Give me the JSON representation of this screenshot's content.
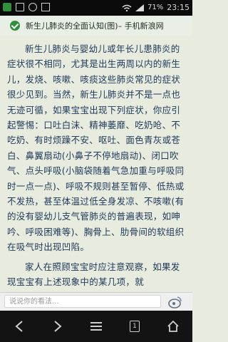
{
  "status": {
    "time": "23:15",
    "battery": "71%"
  },
  "page": {
    "title": "新生儿肺炎的全面认知(图)– 手机新浪网"
  },
  "article": {
    "paragraphs": [
      "新生儿肺炎与婴幼儿或年长儿患肺炎的症状很不相同，尤其是出生两周以内的新生儿，发烧、咳嗽、咳痰这些肺炎常见的症状很少见到。当然，新生儿肺炎并不是一点也无迹可循，如果宝宝出现下列症状，你应引起警惕：口吐白沫、精神萎靡、吃奶呛、不吃奶、有时烦躁不安、呕吐、面色青灰或苍白、鼻翼扇动(小鼻子不停地扇动)、闭口吹气、点头呼吸(小脑袋随着气急加重与呼吸同时一点一点)、呼吸不规则甚至暂停、低热或不发热，甚至体温过低全身发凉、不咳嗽(有的没有婴幼儿支气管肺炎的普遍表现，如呻吟、呼吸困难等)、胸骨上、肋骨间的软组织在吸气时出现凹陷。",
      "家人在照顾宝宝时应注意观察，如果发现宝宝有上述现象中的某几项，就"
    ]
  },
  "comment": {
    "placeholder": "说说你的看法..."
  },
  "nav": {
    "tab_count": "1"
  },
  "colors": {
    "accent_green": "#2f8f3a",
    "text_blue": "#203a5b"
  }
}
